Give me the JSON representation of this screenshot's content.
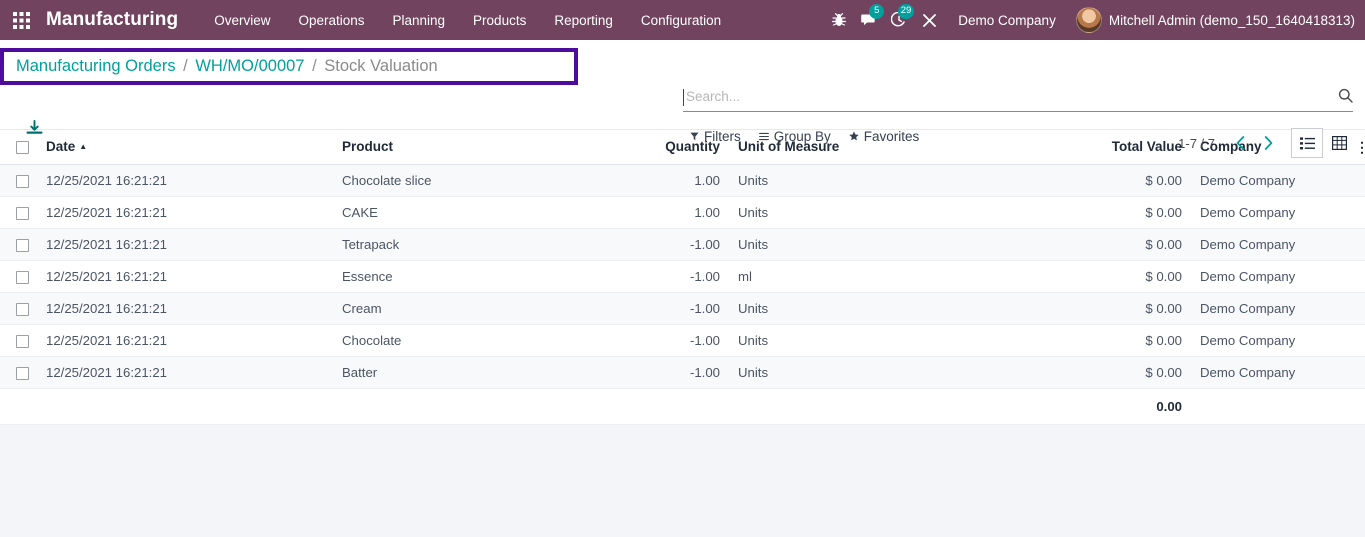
{
  "navbar": {
    "apps_icon": "apps-grid-icon",
    "brand": "Manufacturing",
    "menu": [
      {
        "label": "Overview"
      },
      {
        "label": "Operations"
      },
      {
        "label": "Planning"
      },
      {
        "label": "Products"
      },
      {
        "label": "Reporting"
      },
      {
        "label": "Configuration"
      }
    ],
    "icons": [
      {
        "name": "bug-icon",
        "badge": null
      },
      {
        "name": "messages-icon",
        "badge": "5"
      },
      {
        "name": "activities-clock-icon",
        "badge": "29"
      },
      {
        "name": "tools-icon",
        "badge": null
      }
    ],
    "company": "Demo Company",
    "user": "Mitchell Admin (demo_150_1640418313)",
    "bg_color": "#71435f",
    "badge_color": "#00a09d"
  },
  "breadcrumb": {
    "items": [
      {
        "label": "Manufacturing Orders",
        "active": false
      },
      {
        "label": "WH/MO/00007",
        "active": false
      },
      {
        "label": "Stock Valuation",
        "active": true
      }
    ],
    "separator": "/",
    "highlight_color": "#4d0c9c",
    "link_color": "#00a09d"
  },
  "toolbar": {
    "download_icon": "download-icon"
  },
  "search": {
    "value": "",
    "placeholder": "Search...",
    "search_icon": "search-icon"
  },
  "filters": [
    {
      "label": "Filters",
      "icon": "filter-funnel-icon"
    },
    {
      "label": "Group By",
      "icon": "group-by-lines-icon"
    },
    {
      "label": "Favorites",
      "icon": "star-icon"
    }
  ],
  "pager": {
    "range": "1-7 / 7",
    "prev_icon": "chevron-left-icon",
    "next_icon": "chevron-right-icon"
  },
  "views": [
    {
      "name": "list-view",
      "icon": "list-icon",
      "active": true
    },
    {
      "name": "pivot-view",
      "icon": "pivot-table-icon",
      "active": false
    }
  ],
  "table": {
    "columns": [
      {
        "label": "Date",
        "align": "left",
        "sorted": "asc"
      },
      {
        "label": "Product",
        "align": "left"
      },
      {
        "label": "Quantity",
        "align": "right"
      },
      {
        "label": "Unit of Measure",
        "align": "left"
      },
      {
        "label": "Total Value",
        "align": "right"
      },
      {
        "label": "Company",
        "align": "left"
      }
    ],
    "optional_columns_icon": "vertical-dots-icon",
    "rows": [
      {
        "date": "12/25/2021 16:21:21",
        "product": "Chocolate slice",
        "quantity": "1.00",
        "uom": "Units",
        "total_value": "$ 0.00",
        "company": "Demo Company"
      },
      {
        "date": "12/25/2021 16:21:21",
        "product": "CAKE",
        "quantity": "1.00",
        "uom": "Units",
        "total_value": "$ 0.00",
        "company": "Demo Company"
      },
      {
        "date": "12/25/2021 16:21:21",
        "product": "Tetrapack",
        "quantity": "-1.00",
        "uom": "Units",
        "total_value": "$ 0.00",
        "company": "Demo Company"
      },
      {
        "date": "12/25/2021 16:21:21",
        "product": "Essence",
        "quantity": "-1.00",
        "uom": "ml",
        "total_value": "$ 0.00",
        "company": "Demo Company"
      },
      {
        "date": "12/25/2021 16:21:21",
        "product": "Cream",
        "quantity": "-1.00",
        "uom": "Units",
        "total_value": "$ 0.00",
        "company": "Demo Company"
      },
      {
        "date": "12/25/2021 16:21:21",
        "product": "Chocolate",
        "quantity": "-1.00",
        "uom": "Units",
        "total_value": "$ 0.00",
        "company": "Demo Company"
      },
      {
        "date": "12/25/2021 16:21:21",
        "product": "Batter",
        "quantity": "-1.00",
        "uom": "Units",
        "total_value": "$ 0.00",
        "company": "Demo Company"
      }
    ],
    "footer": {
      "total_value": "0.00"
    }
  }
}
